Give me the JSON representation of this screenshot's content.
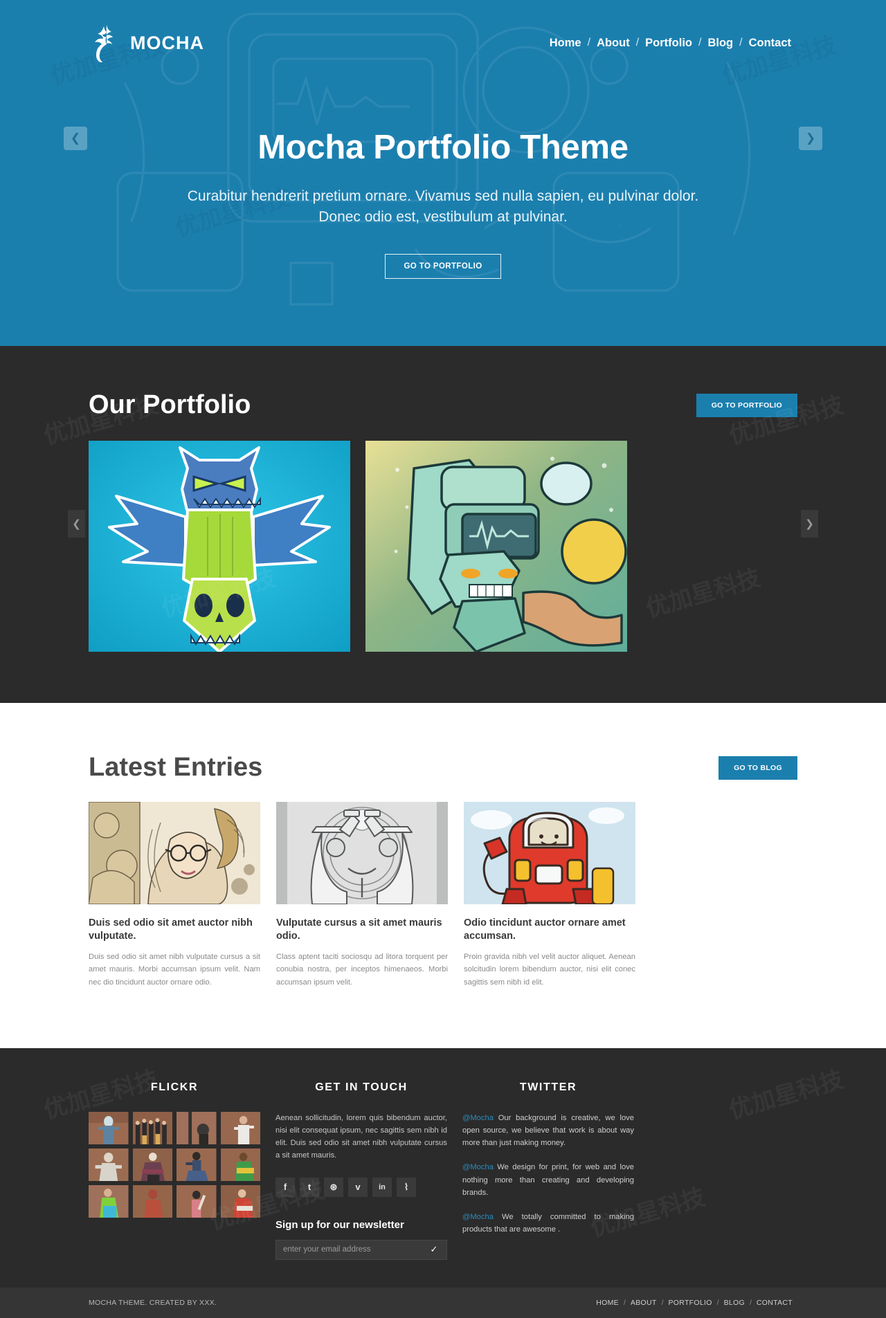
{
  "brand": {
    "name": "MOCHA",
    "logo_icon": "deer-antler-logo-icon"
  },
  "nav": {
    "items": [
      "Home",
      "About",
      "Portfolio",
      "Blog",
      "Contact"
    ],
    "separator": "/"
  },
  "hero": {
    "title": "Mocha Portfolio Theme",
    "subtitle": "Curabitur hendrerit pretium ornare. Vivamus sed nulla sapien, eu pulvinar dolor. Donec odio est, vestibulum at pulvinar.",
    "cta_label": "GO TO PORTFOLIO",
    "prev_icon": "chevron-left-icon",
    "next_icon": "chevron-right-icon",
    "bg_color": "#1b7fae"
  },
  "portfolio": {
    "title": "Our Portfolio",
    "cta_label": "GO TO PORTFOLIO",
    "prev_icon": "chevron-left-icon",
    "next_icon": "chevron-right-icon",
    "bg_color": "#2b2b2b",
    "items": [
      {
        "alt": "blue horned monster over green skull totem illustration"
      },
      {
        "alt": "teal robot graffiti character illustration"
      }
    ]
  },
  "blog": {
    "title": "Latest Entries",
    "cta_label": "GO TO BLOG",
    "entries": [
      {
        "title": "Duis sed odio sit amet auctor nibh vulputate.",
        "text": "Duis sed odio sit amet nibh vulputate cursus a sit amet mauris. Morbi accumsan ipsum velit. Nam nec dio tincidunt auctor ornare odio.",
        "alt": "illustrated blonde woman with glasses artwork"
      },
      {
        "title": "Vulputate cursus a sit amet mauris odio.",
        "text": "Class aptent taciti sociosqu ad litora torquent per conubia nostra, per inceptos himenaeos. Morbi accumsan ipsum velit.",
        "alt": "grayscale duel gentlemen crest illustration"
      },
      {
        "title": "Odio tincidunt auctor ornare amet accumsan.",
        "text": "Proin gravida nibh vel velit auctor aliquet. Aenean solcitudin lorem bibendum auctor, nisi elit conec sagittis sem nibh id elit.",
        "alt": "red astronaut robot cartoon illustration"
      }
    ]
  },
  "footer": {
    "flickr": {
      "heading": "FLICKR",
      "thumbs": [
        "person in blue outfit on red rock",
        "group of costumed people",
        "person with long pole",
        "person in white shirt",
        "person in grey hoodie",
        "person in dark purple outfit",
        "person in blue skirt",
        "person in green and yellow",
        "person in bright green suit",
        "person in red body paint",
        "person with baseball bat",
        "person in red costume"
      ]
    },
    "contact": {
      "heading": "GET IN TOUCH",
      "text": "Aenean sollicitudin, lorem quis bibendum auctor, nisi elit consequat ipsum, nec sagittis sem nibh id elit. Duis sed odio sit amet nibh vulputate cursus a sit amet mauris.",
      "social": [
        {
          "name": "facebook-icon",
          "glyph": "f"
        },
        {
          "name": "tumblr-icon",
          "glyph": "t"
        },
        {
          "name": "dribbble-icon",
          "glyph": "⊛"
        },
        {
          "name": "vimeo-icon",
          "glyph": "v"
        },
        {
          "name": "linkedin-icon",
          "glyph": "in"
        },
        {
          "name": "rss-icon",
          "glyph": "⌇"
        }
      ],
      "newsletter_title": "Sign up for our newsletter",
      "newsletter_placeholder": "enter your email address",
      "newsletter_value": "",
      "newsletter_submit_icon": "✓"
    },
    "twitter": {
      "heading": "TWITTER",
      "handle": "@Mocha",
      "tweets": [
        "Our background is creative, we love open source, we believe that work is about way more than just making money.",
        "We design for print, for web and love nothing more than creating and developing brands.",
        "We totally committed to making products that are awesome ."
      ],
      "handle_color": "#2b8cbe"
    },
    "bottom": {
      "copyright": "MOCHA THEME. CREATED BY XXX.",
      "nav": [
        "HOME",
        "ABOUT",
        "PORTFOLIO",
        "BLOG",
        "CONTACT"
      ],
      "separator": "/"
    }
  },
  "watermark": {
    "text": "优加星科技"
  }
}
